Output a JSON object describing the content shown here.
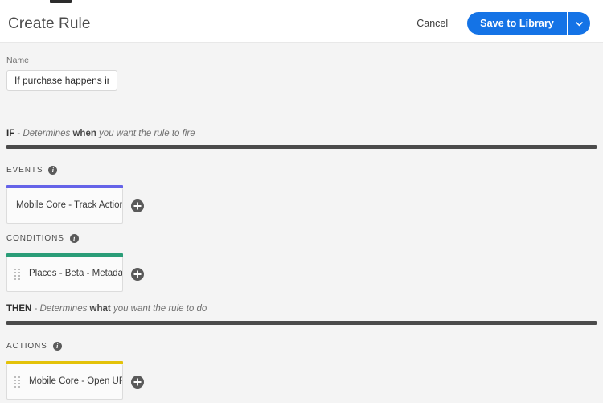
{
  "header": {
    "title": "Create Rule",
    "cancel_label": "Cancel",
    "save_label": "Save to Library",
    "save_menu_icon": "chevron-down-icon"
  },
  "name_field": {
    "label": "Name",
    "value": "If purchase happens in-store",
    "placeholder": "Name"
  },
  "if_section": {
    "keyword": "IF",
    "dash": " - ",
    "text_before": "Determines ",
    "emphasis": "when",
    "text_after": " you want the rule to fire"
  },
  "then_section": {
    "keyword": "THEN",
    "dash": " - ",
    "text_before": "Determines ",
    "emphasis": "what",
    "text_after": " you want the rule to do"
  },
  "groups": {
    "events": {
      "label": "EVENTS",
      "info_icon": "info-icon",
      "info_glyph": "i",
      "accent_color": "#6563e8",
      "add_label": "+",
      "add_icon": "plus-circle-icon",
      "items": [
        {
          "label": "Mobile Core - Track Action",
          "has_drag_handle": false
        }
      ]
    },
    "conditions": {
      "label": "CONDITIONS",
      "info_icon": "info-icon",
      "info_glyph": "i",
      "accent_color": "#2a9d78",
      "add_label": "+",
      "add_icon": "plus-circle-icon",
      "items": [
        {
          "label": "Places - Beta - Metadata",
          "has_drag_handle": true
        }
      ]
    },
    "actions": {
      "label": "ACTIONS",
      "info_icon": "info-icon",
      "info_glyph": "i",
      "accent_color": "#e3c20a",
      "add_label": "+",
      "add_icon": "plus-circle-icon",
      "items": [
        {
          "label": "Mobile Core - Open URL",
          "has_drag_handle": true
        }
      ]
    }
  },
  "colors": {
    "primary": "#1473e6",
    "divider": "#4b4b4b",
    "background": "#f4f4f4",
    "surface": "#ffffff"
  }
}
